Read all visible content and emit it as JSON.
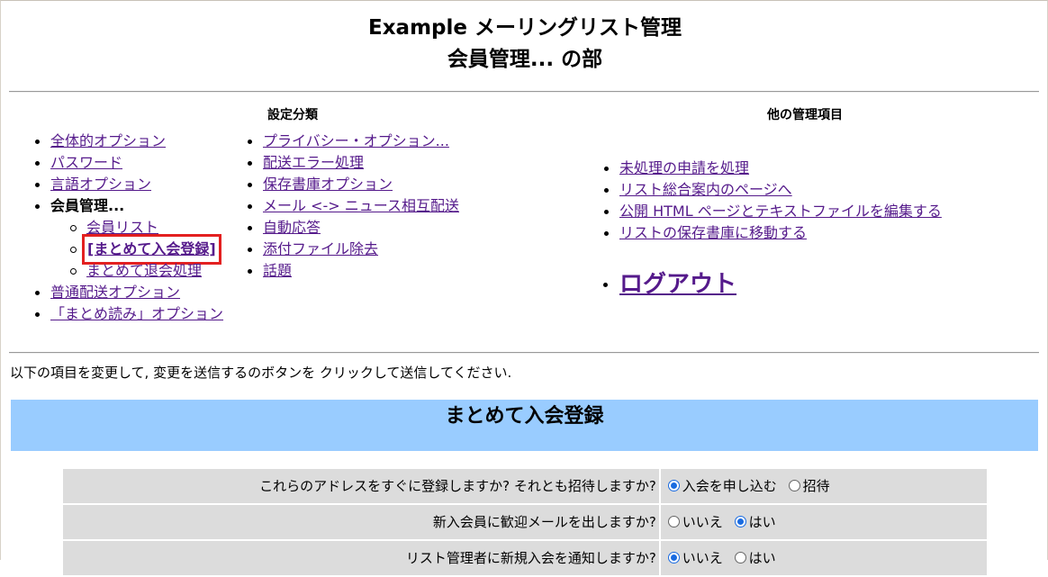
{
  "header": {
    "title": "Example メーリングリスト管理",
    "subtitle": "会員管理... の部"
  },
  "settings": {
    "heading": "設定分類",
    "col1": [
      {
        "label": "全体的オプション"
      },
      {
        "label": "パスワード"
      },
      {
        "label": "言語オプション"
      },
      {
        "label": "会員管理..."
      },
      {
        "label": "会員リスト"
      },
      {
        "label": "[まとめて入会登録]"
      },
      {
        "label": "まとめて退会処理"
      },
      {
        "label": "普通配送オプション"
      },
      {
        "label": "「まとめ読み」オプション"
      }
    ],
    "col2": [
      {
        "label": "プライバシー・オプション..."
      },
      {
        "label": "配送エラー処理"
      },
      {
        "label": "保存書庫オプション"
      },
      {
        "label": "メール <-> ニュース相互配送"
      },
      {
        "label": "自動応答"
      },
      {
        "label": "添付ファイル除去"
      },
      {
        "label": "話題"
      }
    ]
  },
  "other": {
    "heading": "他の管理項目",
    "items": [
      {
        "label": "未処理の申請を処理"
      },
      {
        "label": "リスト総合案内のページへ"
      },
      {
        "label": "公開 HTML ページとテキストファイルを編集する"
      },
      {
        "label": "リストの保存書庫に移動する"
      }
    ],
    "logout": "ログアウト"
  },
  "intro": "以下の項目を変更して, 変更を送信するのボタンを クリックして送信してください.",
  "section_title": "まとめて入会登録",
  "form": {
    "rows": [
      {
        "question": "これらのアドレスをすぐに登録しますか? それとも招待しますか?",
        "opt1": "入会を申し込む",
        "opt2": "招待",
        "selected": 1
      },
      {
        "question": "新入会員に歓迎メールを出しますか?",
        "opt1": "いいえ",
        "opt2": "はい",
        "selected": 2
      },
      {
        "question": "リスト管理者に新規入会を通知しますか?",
        "opt1": "いいえ",
        "opt2": "はい",
        "selected": 1
      }
    ]
  }
}
